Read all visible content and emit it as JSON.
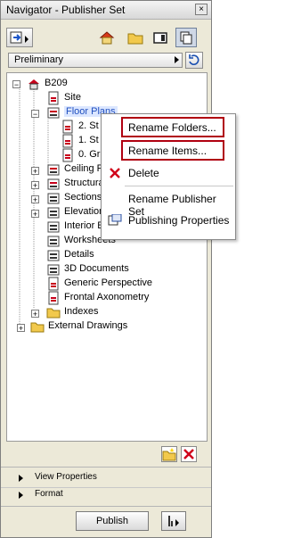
{
  "window": {
    "title": "Navigator - Publisher Set",
    "close_glyph": "×"
  },
  "toolbar": {
    "selected_tool": "publisher-set-view",
    "icons": [
      "publish-target-icon",
      "house-icon",
      "folder-icon",
      "layout-icon",
      "selected-view-icon"
    ]
  },
  "set_selector": {
    "value": "Preliminary"
  },
  "tree": {
    "root": "B209",
    "items": [
      {
        "label": "Site"
      },
      {
        "label": "Floor Plans"
      },
      {
        "label": "2. St"
      },
      {
        "label": "1. St"
      },
      {
        "label": "0. Gr"
      },
      {
        "label": "Ceiling Pl"
      },
      {
        "label": "Structura"
      },
      {
        "label": "Sections"
      },
      {
        "label": "Elevation"
      },
      {
        "label": "Interior E"
      },
      {
        "label": "Worksheets"
      },
      {
        "label": "Details"
      },
      {
        "label": "3D Documents"
      },
      {
        "label": "Generic Perspective"
      },
      {
        "label": "Frontal Axonometry"
      },
      {
        "label": "Indexes"
      },
      {
        "label": "External Drawings"
      }
    ]
  },
  "context_menu": {
    "rename_folders": "Rename Folders...",
    "rename_items": "Rename Items...",
    "delete": "Delete",
    "rename_publisher_set": "Rename Publisher Set",
    "publishing_properties": "Publishing Properties"
  },
  "panels": {
    "view_properties": "View Properties",
    "format": "Format"
  },
  "footer": {
    "publish": "Publish"
  }
}
